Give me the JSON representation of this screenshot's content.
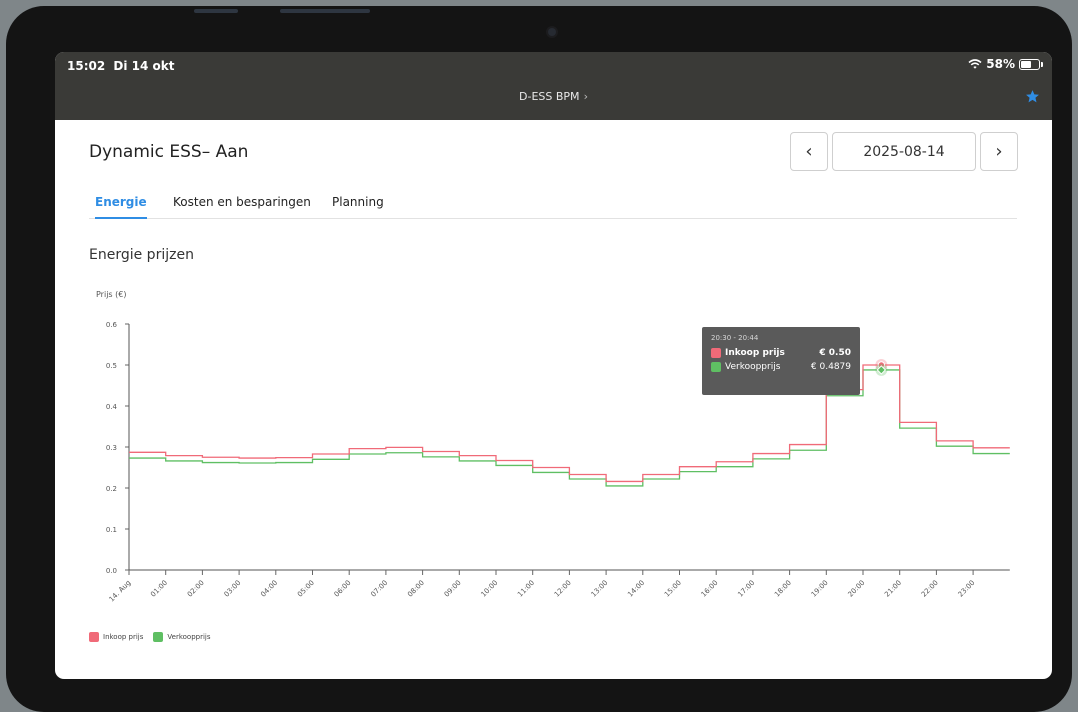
{
  "status_bar": {
    "time": "15:02",
    "date": "Di 14 okt",
    "battery": "58%",
    "battery_level": 0.58
  },
  "nav": {
    "title": "D-ESS BPM",
    "chevron": "›",
    "favorite_icon": "star-icon",
    "accent": "#2f8de4"
  },
  "header": {
    "title": "Dynamic ESS– Aan",
    "prev_label": "‹",
    "next_label": "›",
    "date": "2025-08-14"
  },
  "tabs": [
    {
      "label": "Energie",
      "active": true
    },
    {
      "label": "Kosten en besparingen",
      "active": false
    },
    {
      "label": "Planning",
      "active": false
    }
  ],
  "section_title": "Energie prijzen",
  "chart_data": {
    "type": "line",
    "step": true,
    "ylabel": "Prijs (€)",
    "ylim": [
      0,
      0.6
    ],
    "yticks": [
      "0.0",
      "0.1",
      "0.2",
      "0.3",
      "0.4",
      "0.5",
      "0.6"
    ],
    "xticks": [
      "14. Aug",
      "01:00",
      "02:00",
      "03:00",
      "04:00",
      "05:00",
      "06:00",
      "07:00",
      "08:00",
      "09:00",
      "10:00",
      "11:00",
      "12:00",
      "13:00",
      "14:00",
      "15:00",
      "16:00",
      "17:00",
      "18:00",
      "19:00",
      "20:00",
      "21:00",
      "22:00",
      "23:00"
    ],
    "x_hours": [
      0,
      1,
      2,
      3,
      4,
      5,
      6,
      7,
      8,
      9,
      10,
      11,
      12,
      13,
      14,
      15,
      16,
      17,
      18,
      19,
      20,
      21,
      22,
      23
    ],
    "series": [
      {
        "name": "Inkoop prijs",
        "color": "#f06a78",
        "values": [
          0.287,
          0.279,
          0.275,
          0.273,
          0.274,
          0.283,
          0.296,
          0.299,
          0.289,
          0.279,
          0.267,
          0.25,
          0.233,
          0.216,
          0.233,
          0.252,
          0.264,
          0.284,
          0.306,
          0.44,
          0.5,
          0.36,
          0.315,
          0.298
        ]
      },
      {
        "name": "Verkoopprijs",
        "color": "#5fbf63",
        "values": [
          0.273,
          0.266,
          0.262,
          0.261,
          0.262,
          0.27,
          0.283,
          0.286,
          0.276,
          0.266,
          0.255,
          0.238,
          0.222,
          0.205,
          0.222,
          0.24,
          0.252,
          0.271,
          0.292,
          0.425,
          0.488,
          0.346,
          0.302,
          0.284
        ]
      }
    ],
    "tooltip": {
      "time": "20:30 - 20:44",
      "x_hour": 20.5,
      "rows": [
        {
          "name": "Inkoop prijs",
          "value": "€ 0.50",
          "bold": true
        },
        {
          "name": "Verkoopprijs",
          "value": "€ 0.4879",
          "bold": false
        }
      ]
    },
    "legend": [
      {
        "name": "Inkoop prijs",
        "color": "#f06a78"
      },
      {
        "name": "Verkoopprijs",
        "color": "#5fbf63"
      }
    ]
  }
}
